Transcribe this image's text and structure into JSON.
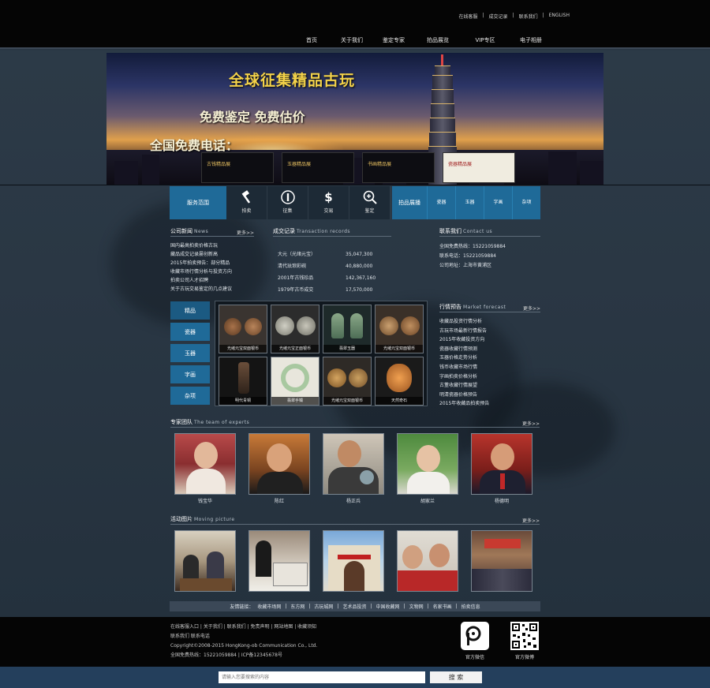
{
  "top": {
    "links": [
      "在线客服",
      "成交记录",
      "联系我们",
      "ENGLISH"
    ],
    "nav": [
      "首页",
      "关于我们",
      "鉴定专家",
      "拍品展览",
      "VIP专区",
      "电子相册"
    ]
  },
  "banner": {
    "headline": "全球征集精品古玩",
    "subline": "免费鉴定 免费估价",
    "phone_label": "全国免费电话：",
    "thumbs": [
      "古钱精品展",
      "玉器精品展",
      "书画精品展",
      "瓷器精品展"
    ]
  },
  "services": {
    "title": "服务范围",
    "items": [
      {
        "label": "拍卖",
        "icon": "gavel-icon"
      },
      {
        "label": "征集",
        "icon": "info-icon"
      },
      {
        "label": "交易",
        "icon": "dollar-icon"
      },
      {
        "label": "鉴定",
        "icon": "zoom-in-icon"
      }
    ],
    "auction_title": "拍品展播",
    "auction_items": [
      "瓷器",
      "玉器",
      "字画",
      "杂项"
    ]
  },
  "news": {
    "title": "公司新闻",
    "subtitle": "News",
    "more": "更多>>",
    "items": [
      "国内最高拍卖价格古玩",
      "藏品成交记录屡创新高",
      "2015年拍卖预告：部分精品",
      "收藏市场行情分析与投资方向",
      "拍卖公司人才招聘",
      "关于古玩交易鉴定的几点建议"
    ]
  },
  "deals": {
    "title": "成交记录",
    "subtitle": "Transaction records",
    "rows": [
      {
        "name": "大元（光绪元宝）",
        "price": "35,047,300"
      },
      {
        "name": "清代珐琅彩碗",
        "price": "40,880,000"
      },
      {
        "name": "2001年古钱珍品",
        "price": "142,367,160"
      },
      {
        "name": "1979年古币成交",
        "price": "17,570,000"
      }
    ]
  },
  "contact": {
    "title": "联系我们",
    "subtitle": "Contact us",
    "lines": [
      "全国免费热线：15221059884",
      "联系电话：15221059884",
      "公司地址：上海市黄浦区"
    ]
  },
  "categories": [
    "精品",
    "瓷器",
    "玉器",
    "字画",
    "杂项"
  ],
  "gallery": [
    "光绪元宝双面银币",
    "光绪元宝正面银币",
    "翡翠玉器",
    "光绪元宝双面银币",
    "明代青铜",
    "翡翠手镯",
    "光绪元宝双面银币",
    "天然奇石"
  ],
  "forecast": {
    "title": "行情预告",
    "subtitle": "Market forecast",
    "more": "更多>>",
    "items": [
      "收藏品投资行情分析",
      "古玩市场最新行情报告",
      "2015年收藏投资方向",
      "瓷器收藏行情预测",
      "玉器价格走势分析",
      "钱币收藏市场行情",
      "字画拍卖价格分析",
      "古董收藏行情展望",
      "明清瓷器价格预告",
      "2015年收藏品拍卖预告"
    ]
  },
  "experts": {
    "title": "专家团队",
    "subtitle": "The team of experts",
    "more": "更多>>",
    "names": [
      "钱宝华",
      "陈红",
      "杨正兵",
      "胡家兰",
      "杨德明"
    ]
  },
  "activity": {
    "title": "活动图片",
    "subtitle": "Moving picture",
    "more": "更多>>"
  },
  "links": {
    "label": "友情链接：",
    "items": [
      "收藏市场网",
      "东方网",
      "古玩城网",
      "艺术品投资",
      "中国收藏网",
      "文物网",
      "名家书画",
      "拍卖信息"
    ]
  },
  "footer": {
    "lines": [
      "在线客服入口 | 关于我们 | 联系我们 | 免责声明 | 网站地图 | 收藏须知",
      "联系我们 联系电话",
      "Copyright©2008-2015 HongKong-ob Communication Co., Ltd.",
      "全国免费热线：15221059884 | ICP备12345678号"
    ],
    "qr1_label": "官方微信",
    "qr2_label": "官方微博"
  },
  "search": {
    "placeholder": "请输入您要搜索的内容",
    "button": "搜 索"
  }
}
